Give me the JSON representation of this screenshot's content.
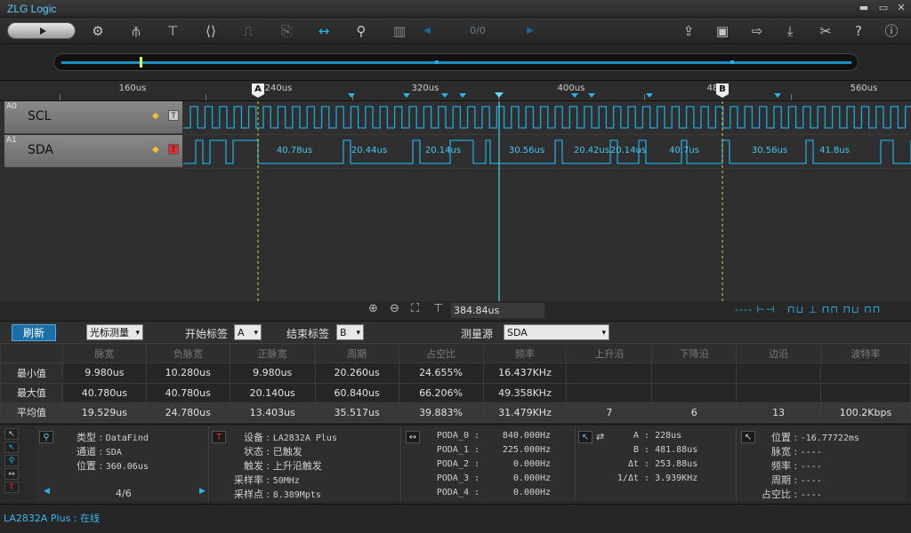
{
  "app": {
    "title": "ZLG Logic",
    "window_controls": [
      "▬",
      "▭",
      "✕"
    ]
  },
  "toolbar": {
    "left_icons": [
      "gear-icon",
      "probe-icon",
      "text-icon",
      "bus-icon",
      "step-icon",
      "export-icon",
      "measure-width-icon",
      "search-icon",
      "memory-icon"
    ],
    "right_icons": [
      "open-icon",
      "save-icon",
      "save-as-icon",
      "download-icon",
      "tools-icon",
      "help-icon",
      "info-icon"
    ],
    "nav_count": "0/0"
  },
  "ruler": {
    "ticks": [
      {
        "label": "160us"
      },
      {
        "label": "240us"
      },
      {
        "label": "320us"
      },
      {
        "label": "400us"
      },
      {
        "label": "48"
      },
      {
        "label": "560us"
      }
    ],
    "marker_a": "A",
    "marker_b": "B"
  },
  "channels": [
    {
      "id": "A0",
      "name": "SCL",
      "trig": "T"
    },
    {
      "id": "A1",
      "name": "SDA",
      "trig": "T"
    }
  ],
  "sda_labels": [
    "40.78us",
    "20.44us",
    "20.14us",
    "30.56us",
    "20.42us",
    "20.14us",
    "40.7us",
    "30.56us",
    "41.8us"
  ],
  "zoombar": {
    "cursor_time": "384.84us",
    "legend": "----"
  },
  "measure": {
    "refresh": "刷新",
    "mode": "光标测量",
    "start_label_caption": "开始标签",
    "start_label": "A",
    "end_label_caption": "结束标签",
    "end_label": "B",
    "source_caption": "测量源",
    "source": "SDA"
  },
  "table": {
    "headers": [
      "",
      "脉宽",
      "负脉宽",
      "正脉宽",
      "周期",
      "占空比",
      "频率",
      "上升沿",
      "下降沿",
      "边沿",
      "波特率"
    ],
    "rows": [
      [
        "最小值",
        "9.980us",
        "10.280us",
        "9.980us",
        "20.260us",
        "24.655%",
        "16.437KHz",
        "",
        "",
        "",
        ""
      ],
      [
        "最大值",
        "40.780us",
        "40.780us",
        "20.140us",
        "60.840us",
        "66.206%",
        "49.358KHz",
        "",
        "",
        "",
        ""
      ],
      [
        "平均值",
        "19.529us",
        "24.780us",
        "13.403us",
        "35.517us",
        "39.883%",
        "31.479KHz",
        "7",
        "6",
        "13",
        "100.2Kbps"
      ]
    ]
  },
  "find": {
    "type_k": "类型",
    "type_v": "DataFind",
    "chan_k": "通道",
    "chan_v": "SDA",
    "pos_k": "位置",
    "pos_v": "360.06us",
    "page": "4/6"
  },
  "device": {
    "dev_k": "设备",
    "dev_v": "LA2832A Plus",
    "state_k": "状态",
    "state_v": "已触发",
    "trig_k": "触发",
    "trig_v": "上升沿触发",
    "rate_k": "采样率",
    "rate_v": "50MHz",
    "pts_k": "采样点",
    "pts_v": "8.389Mpts"
  },
  "poda": [
    {
      "k": "PODA_0",
      "v": "840.000Hz"
    },
    {
      "k": "PODA_1",
      "v": "225.000Hz"
    },
    {
      "k": "PODA_2",
      "v": "0.000Hz"
    },
    {
      "k": "PODA_3",
      "v": "0.000Hz"
    },
    {
      "k": "PODA_4",
      "v": "0.000Hz"
    }
  ],
  "cursor": {
    "a_k": "A",
    "a_v": "228us",
    "b_k": "B",
    "b_v": "481.88us",
    "dt_k": "Δt",
    "dt_v": "253.88us",
    "inv_k": "1/Δt",
    "inv_v": "3.939KHz"
  },
  "pointer": {
    "pos_k": "位置",
    "pos_v": "-16.77722ms",
    "pw_k": "脉宽",
    "pw_v": "----",
    "freq_k": "频率",
    "freq_v": "----",
    "per_k": "周期",
    "per_v": "----",
    "duty_k": "占空比",
    "duty_v": "----"
  },
  "status": {
    "text": "LA2832A Plus : 在线"
  }
}
